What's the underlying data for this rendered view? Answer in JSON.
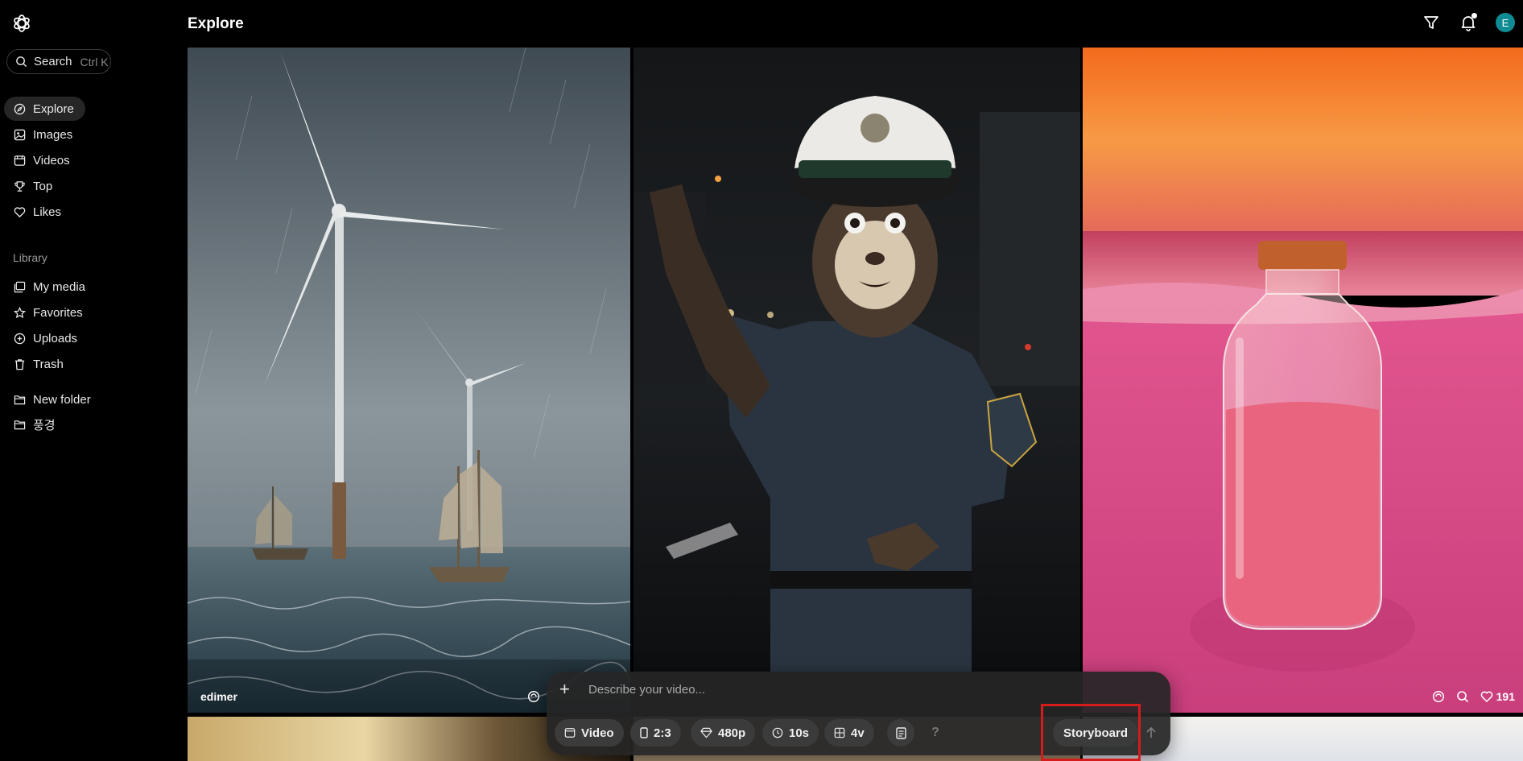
{
  "header": {
    "title": "Explore"
  },
  "sidebar": {
    "search_label": "Search",
    "search_shortcut": "Ctrl K",
    "nav": [
      {
        "label": "Explore",
        "icon": "compass-icon"
      },
      {
        "label": "Images",
        "icon": "image-icon"
      },
      {
        "label": "Videos",
        "icon": "film-icon"
      },
      {
        "label": "Top",
        "icon": "trophy-icon"
      },
      {
        "label": "Likes",
        "icon": "heart-icon"
      }
    ],
    "library_label": "Library",
    "library": [
      {
        "label": "My media",
        "icon": "media-icon"
      },
      {
        "label": "Favorites",
        "icon": "star-icon"
      },
      {
        "label": "Uploads",
        "icon": "upload-icon"
      },
      {
        "label": "Trash",
        "icon": "trash-icon"
      }
    ],
    "folders": [
      {
        "label": "New folder",
        "icon": "folder-plus-icon"
      },
      {
        "label": "풍경",
        "icon": "folder-icon"
      }
    ]
  },
  "user": {
    "avatar_letter": "E"
  },
  "tiles": [
    {
      "author": "edimer",
      "subject": "wind turbines and sailing ships in a storm"
    },
    {
      "subject": "ferret in a police uniform at night"
    },
    {
      "subject": "bottle of pink sand on a beach at sunset",
      "likes": "191"
    }
  ],
  "composer": {
    "placeholder": "Describe your video...",
    "type": "Video",
    "aspect": "2:3",
    "resolution": "480p",
    "duration": "10s",
    "variations": "4v",
    "help": "?",
    "storyboard": "Storyboard"
  },
  "colors": {
    "accent_avatar": "#0f8c93",
    "highlight": "#d61b1b"
  }
}
